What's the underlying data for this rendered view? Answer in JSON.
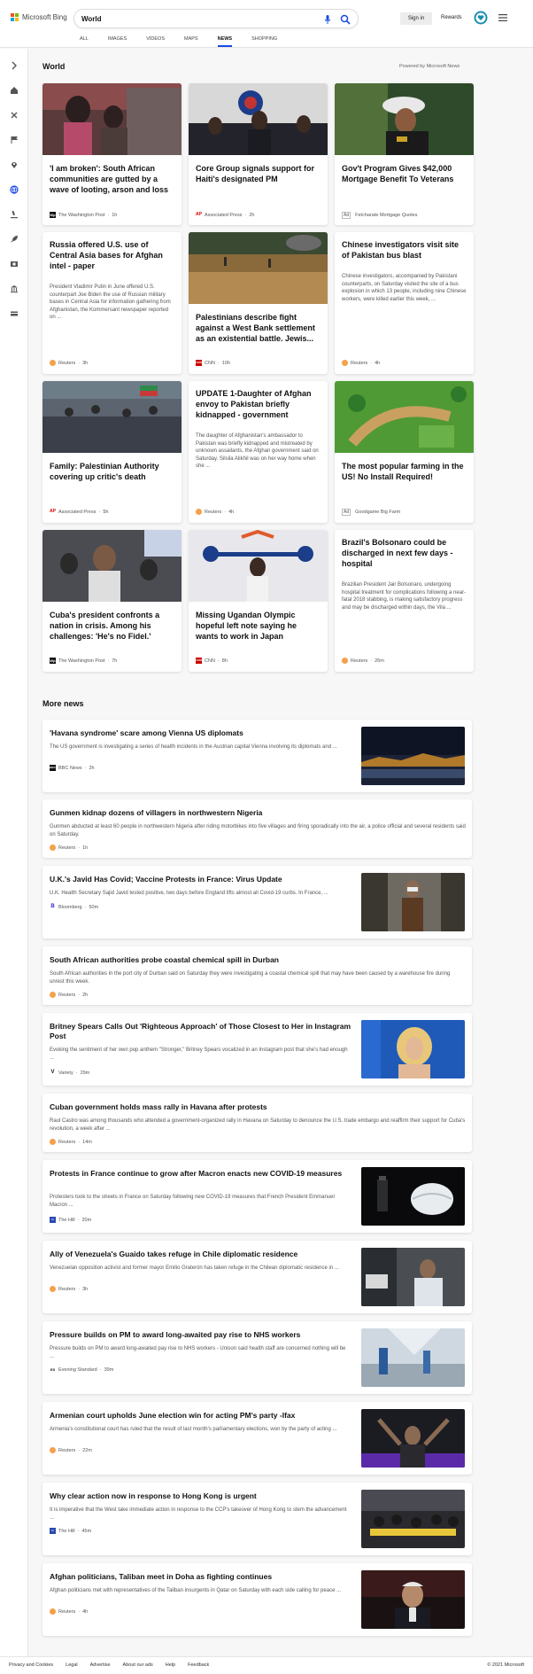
{
  "header": {
    "brand": "Microsoft Bing",
    "search_value": "World",
    "signin_label": "Sign in",
    "rewards_label": "Rewards"
  },
  "tabs": [
    {
      "label": "ALL"
    },
    {
      "label": "IMAGES"
    },
    {
      "label": "VIDEOS"
    },
    {
      "label": "MAPS"
    },
    {
      "label": "NEWS",
      "active": true
    },
    {
      "label": "SHOPPING"
    }
  ],
  "sidebar_icons": [
    "chevron-right-icon",
    "home-icon",
    "tools-icon",
    "flag-icon",
    "location-pin-icon",
    "globe-icon",
    "microscope-icon",
    "rocket-icon",
    "film-icon",
    "bank-icon",
    "money-icon"
  ],
  "world": {
    "title": "World",
    "powered_by": "Powered by Microsoft News",
    "cards": [
      {
        "title": "'I am broken': South African communities are gutted by a wave of looting, arson and loss",
        "snippet": "",
        "source": "The Washington Post",
        "time": "1h",
        "logo": "WP"
      },
      {
        "title": "Core Group signals support for Haiti's designated PM",
        "snippet": "",
        "source": "Associated Press",
        "time": "2h",
        "logo": "AP"
      },
      {
        "title": "Gov't Program Gives $42,000 Mortgage Benefit To Veterans",
        "snippet": "",
        "source": "Fetcharate Mortgage Quotes",
        "time": "",
        "logo": "Ad"
      },
      {
        "title": "Russia offered U.S. use of Central Asia bases for Afghan intel - paper",
        "snippet": "President Vladimir Putin in June offered U.S. counterpart Joe Biden the use of Russian military bases in Central Asia for information gathering from Afghanistan, the Kommersant newspaper reported on ...",
        "source": "Reuters",
        "time": "3h",
        "logo": "R"
      },
      {
        "title": "Palestinians describe fight against a West Bank settlement as an existential battle. Jewis...",
        "snippet": "",
        "source": "CNN",
        "time": "10h",
        "logo": "CNN"
      },
      {
        "title": "Chinese investigators visit site of Pakistan bus blast",
        "snippet": "Chinese investigators, accompanied by Pakistani counterparts, on Saturday visited the site of a bus explosion in which 13 people, including nine Chinese workers, were killed earlier this week, ...",
        "source": "Reuters",
        "time": "4h",
        "logo": "R"
      },
      {
        "title": "Family: Palestinian Authority covering up critic's death",
        "snippet": "",
        "source": "Associated Press",
        "time": "5h",
        "logo": "AP"
      },
      {
        "title": "UPDATE 1-Daughter of Afghan envoy to Pakistan briefly kidnapped - government",
        "snippet": "The daughter of Afghanistan's ambassador to Pakistan was briefly kidnapped and mistreated by unknown assailants, the Afghan government said on Saturday. Silsila Alikhil was on her way home when she ...",
        "source": "Reuters",
        "time": "4h",
        "logo": "R"
      },
      {
        "title": "The most popular farming in the US! No Install Required!",
        "snippet": "",
        "source": "Goodgame Big Farm",
        "time": "",
        "logo": "Ad"
      },
      {
        "title": "Cuba's president confronts a nation in crisis. Among his challenges: 'He's no Fidel.'",
        "snippet": "",
        "source": "The Washington Post",
        "time": "7h",
        "logo": "WP"
      },
      {
        "title": "Missing Ugandan Olympic hopeful left note saying he wants to work in Japan",
        "snippet": "",
        "source": "CNN",
        "time": "8h",
        "logo": "CNN"
      },
      {
        "title": "Brazil's Bolsonaro could be discharged in next few days - hospital",
        "snippet": "Brazilian President Jair Bolsonaro, undergoing hospital treatment for complications following a near-fatal 2018 stabbing, is making satisfactory progress and may be discharged within days, the Vila ...",
        "source": "Reuters",
        "time": "26m",
        "logo": "R"
      }
    ]
  },
  "more_news": {
    "title": "More news",
    "items": [
      {
        "title": "'Havana syndrome' scare among Vienna US diplomats",
        "snippet": "The US government is investigating a series of health incidents in the Austrian capital Vienna involving its diplomats and ...",
        "source": "BBC News",
        "time": "2h"
      },
      {
        "title": "Gunmen kidnap dozens of villagers in northwestern Nigeria",
        "snippet": "Gunmen abducted at least 60 people in northwestern Nigeria after riding motorbikes into five villages and firing sporadically into the air, a police official and several residents said on Saturday.",
        "source": "Reuters",
        "time": "1h"
      },
      {
        "title": "U.K.'s Javid Has Covid; Vaccine Protests in France: Virus Update",
        "snippet": "U.K. Health Secretary Sajid Javid tested positive, two days before England lifts almost all Covid-19 curbs. In France, ...",
        "source": "Bloomberg",
        "time": "50m"
      },
      {
        "title": "South African authorities probe coastal chemical spill in Durban",
        "snippet": "South African authorities in the port city of Durban said on Saturday they were investigating a coastal chemical spill that may have been caused by a warehouse fire during unrest this week.",
        "source": "Reuters",
        "time": "2h"
      },
      {
        "title": "Britney Spears Calls Out 'Righteous Approach' of Those Closest to Her in Instagram Post",
        "snippet": "Evoking the sentiment of her own pop anthem \"Stronger,\" Britney Spears vocalized in an Instagram post that she's had enough ...",
        "source": "Variety",
        "time": "29m"
      },
      {
        "title": "Cuban government holds mass rally in Havana after protests",
        "snippet": "Raul Castro was among thousands who attended a government-organized rally in Havana on Saturday to denounce the U.S. trade embargo and reaffirm their support for Cuba's revolution, a week after ...",
        "source": "Reuters",
        "time": "14m"
      },
      {
        "title": "Protests in France continue to grow after Macron enacts new COVID-19 measures",
        "snippet": "Protesters took to the streets in France on Saturday following new COVID-19 measures that French President Emmanuel Macron ...",
        "source": "The Hill",
        "time": "20m"
      },
      {
        "title": "Ally of Venezuela's Guaido takes refuge in Chile diplomatic residence",
        "snippet": "Venezuelan opposition activist and former mayor Emilio Graterón has taken refuge in the Chilean diplomatic residence in ...",
        "source": "Reuters",
        "time": "3h"
      },
      {
        "title": "Pressure builds on PM to award long-awaited pay rise to NHS workers",
        "snippet": "Pressure builds on PM to award long-awaited pay rise to NHS workers - Unison said health staff are concerned nothing will be ...",
        "source": "Evening Standard",
        "time": "39m"
      },
      {
        "title": "Armenian court upholds June election win for acting PM's party -Ifax",
        "snippet": "Armenia's constitutional court has ruled that the result of last month's parliamentary elections, won by the party of acting ...",
        "source": "Reuters",
        "time": "22m"
      },
      {
        "title": "Why clear action now in response to Hong Kong is urgent",
        "snippet": "It is imperative that the West take immediate action in response to the CCP's takeover of Hong Kong to stem the advancement ...",
        "source": "The Hill",
        "time": "45m"
      },
      {
        "title": "Afghan politicians, Taliban meet in Doha as fighting continues",
        "snippet": "Afghan politicians met with representatives of the Taliban insurgents in Qatar on Saturday with each side calling for peace ...",
        "source": "Reuters",
        "time": "4h"
      }
    ]
  },
  "footer": {
    "links": [
      "Privacy and Cookies",
      "Legal",
      "Advertise",
      "About our ads",
      "Help",
      "Feedback"
    ],
    "copyright": "© 2021 Microsoft"
  },
  "colors": {
    "accent": "#174ae4",
    "reuters": "#f5a04a",
    "cnn": "#cc0000",
    "rewards": "#1d8fb0"
  }
}
